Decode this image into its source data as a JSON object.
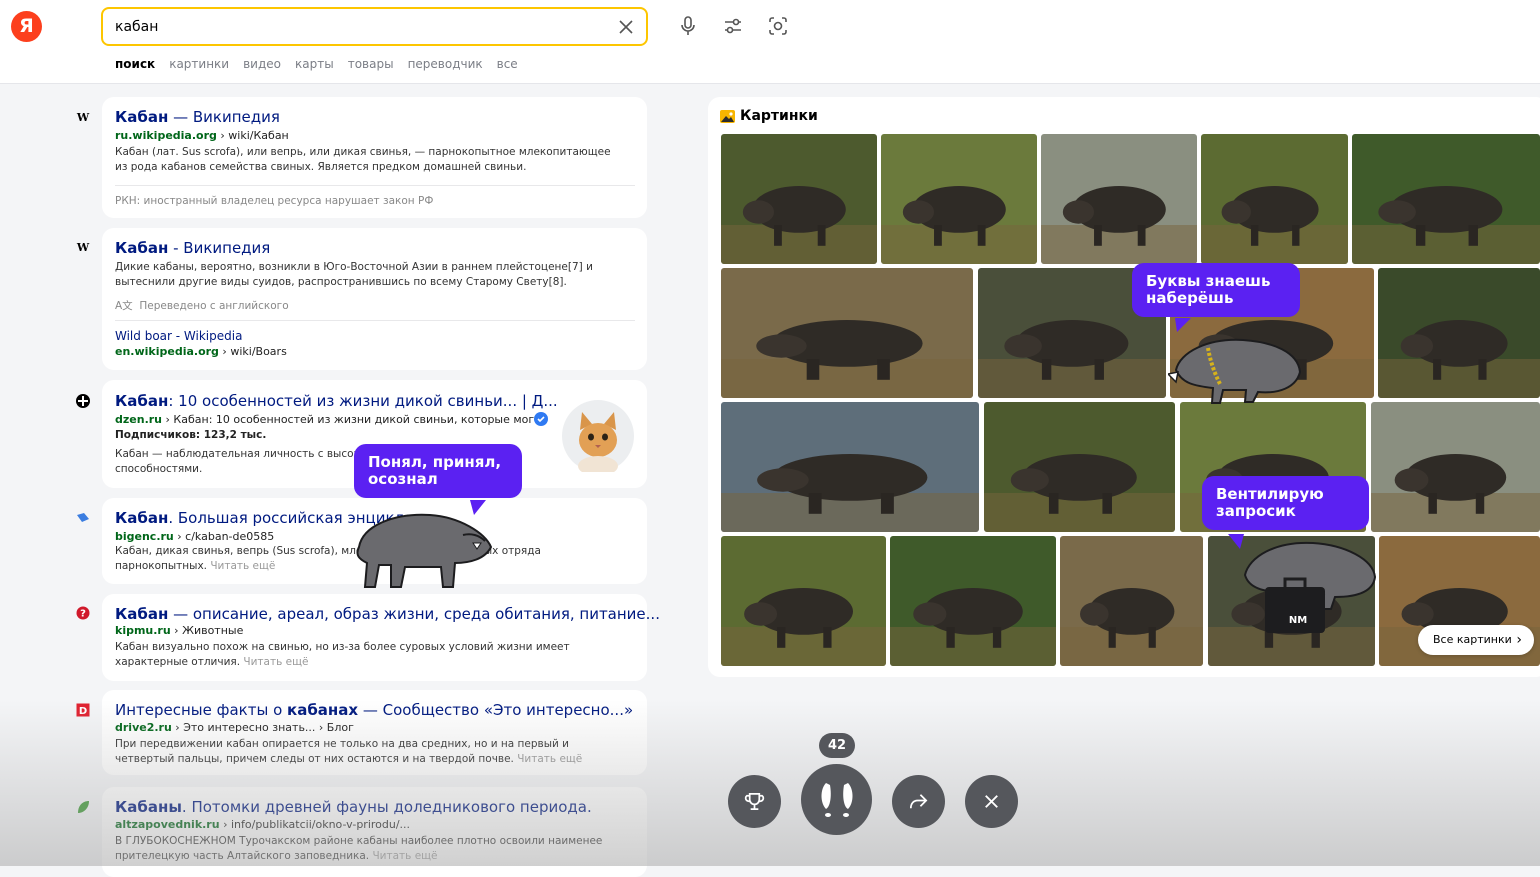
{
  "header": {
    "logo": "Я",
    "search_value": "кабан",
    "tabs": [
      "поиск",
      "картинки",
      "видео",
      "карты",
      "товары",
      "переводчик",
      "все"
    ]
  },
  "results": [
    {
      "title_bold": "Кабан",
      "title_rest": " — Википедия",
      "domain": "ru.wikipedia.org",
      "path": "wiki/Кабан",
      "text": "Кабан (лат. Sus scrofa), или вепрь, или дикая свинья, — парнокопытное млекопитающее из рода кабанов семейства свиных. Является предком домашней свиньи.",
      "note": "РКН: иностранный владелец ресурса нарушает закон РФ"
    },
    {
      "title_bold": "Кабан",
      "title_rest": " - Википедия",
      "text": "Дикие кабаны, вероятно, возникли в Юго-Восточной Азии в раннем плейстоцене[7] и вытеснили другие виды суидов, распространившись по всему Старому Свету[8].",
      "translated": "Переведено с английского",
      "sub_link": "Wild boar - Wikipedia",
      "domain": "en.wikipedia.org",
      "path": "wiki/Boars"
    },
    {
      "title_bold": "Кабан",
      "title_rest": ": 10 особенностей из жизни дикой свиньи... | Д...",
      "domain": "dzen.ru",
      "path": "Кабан: 10 особенностей из жизни дикой свиньи, которые мог...",
      "subscribers": "Подписчиков: 123,2 тыс.",
      "text": "Кабан — наблюдательная личность с высоким",
      "text2": "способностями."
    },
    {
      "title_bold": "Кабан",
      "title_rest": ". Большая российская энцикло",
      "domain": "bigenc.ru",
      "path": "c/kaban-de0585",
      "text": "Кабан, дикая свинья, вепрь (Sus scrofa), млеко",
      "text_right": "ных отряда",
      "text2": "парнокопытных.",
      "more": "Читать ещё"
    },
    {
      "title_bold": "Кабан",
      "title_rest": " — описание, ареал, образ жизни, среда обитания, питание...",
      "domain": "kipmu.ru",
      "path": "Животные",
      "text": "Кабан визуально похож на свинью, но из-за более суровых условий жизни имеет характерные отличия.",
      "more": "Читать ещё"
    },
    {
      "title_pre": "Интересные факты о ",
      "title_bold": "кабанах",
      "title_rest": " — Сообщество «Это интересно...»",
      "domain": "drive2.ru",
      "path": "Это интересно знать... › Блог",
      "text": "При передвижении кабан опирается не только на два средних, но и на первый и четвертый пальцы, причем следы от них остаются и на твердой почве.",
      "more": "Читать ещё"
    },
    {
      "title_bold": "Кабаны",
      "title_rest": ". Потомки древней фауны доледникового периода.",
      "domain": "altzapovednik.ru",
      "path": "info/publikatcii/okno-v-prirodu/...",
      "text": "В ГЛУБОКОСНЕЖНОМ Турочакском районе кабаны наиболее плотно освоили наименее прителецкую часть Алтайского заповедника.",
      "more": "Читать ещё"
    }
  ],
  "images": {
    "title": "Картинки",
    "all_button": "Все картинки"
  },
  "bubbles": {
    "b1": "Понял, принял, осознал",
    "b2": "Буквы знаешь наберёшь",
    "b3": "Вентилирую запросик"
  },
  "controls": {
    "counter": "42",
    "case_label": "NM"
  }
}
